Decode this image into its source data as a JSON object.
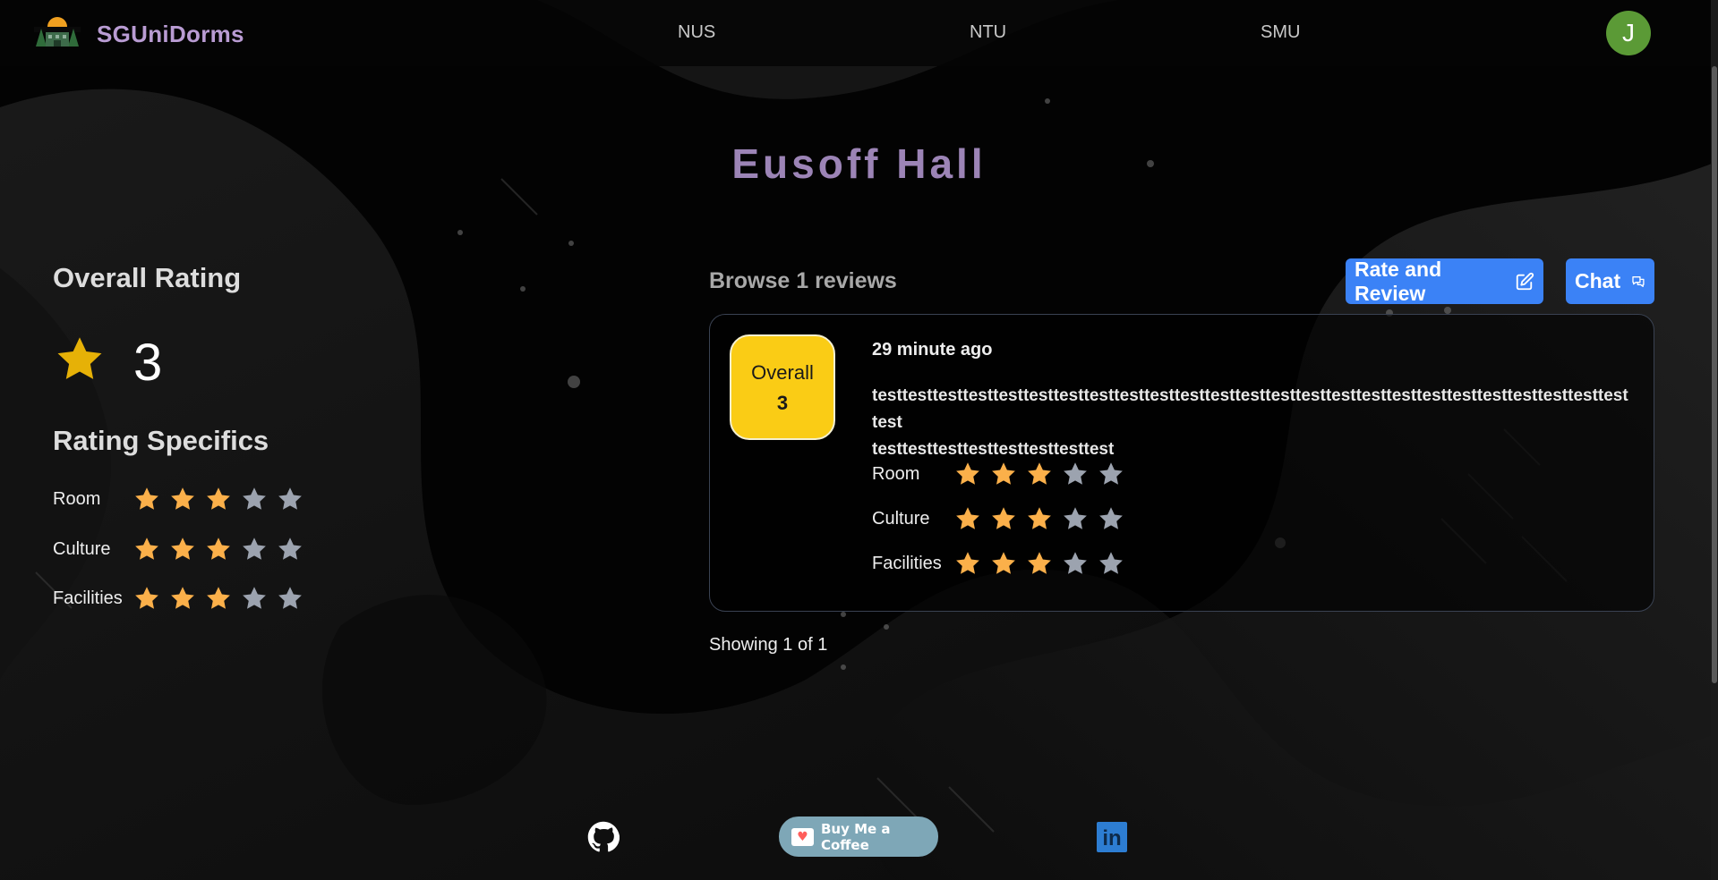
{
  "header": {
    "brand": "SGUniDorms",
    "nav": [
      "NUS",
      "NTU",
      "SMU"
    ],
    "avatar_initial": "J"
  },
  "page_title": "Eusoff Hall",
  "overall": {
    "label": "Overall Rating",
    "value": "3"
  },
  "specifics": {
    "label": "Rating Specifics",
    "rows": [
      {
        "label": "Room",
        "rating": 3,
        "max": 5
      },
      {
        "label": "Culture",
        "rating": 3,
        "max": 5
      },
      {
        "label": "Facilities",
        "rating": 3,
        "max": 5
      }
    ]
  },
  "reviews": {
    "browse_label": "Browse 1 reviews",
    "rate_button": "Rate and Review",
    "chat_button": "Chat",
    "items": [
      {
        "overall_label": "Overall",
        "overall_value": "3",
        "time": "29 minute ago",
        "text_line1": "testtesttesttesttesttesttesttesttesttesttesttesttesttesttesttesttesttesttesttesttesttesttesttesttesttest",
        "text_line2": "testtesttesttesttesttesttesttest",
        "ratings": [
          {
            "label": "Room",
            "rating": 3,
            "max": 5
          },
          {
            "label": "Culture",
            "rating": 3,
            "max": 5
          },
          {
            "label": "Facilities",
            "rating": 3,
            "max": 5
          }
        ]
      }
    ],
    "showing": "Showing 1 of 1"
  },
  "footer": {
    "coffee_label": "Buy Me a Coffee",
    "linkedin_text": "in"
  },
  "colors": {
    "star_filled": "#fbb04a",
    "star_empty": "#9ca3af",
    "accent_blue": "#3b82f6",
    "brand_purple": "#b99cd3",
    "overall_yellow": "#facc15"
  }
}
